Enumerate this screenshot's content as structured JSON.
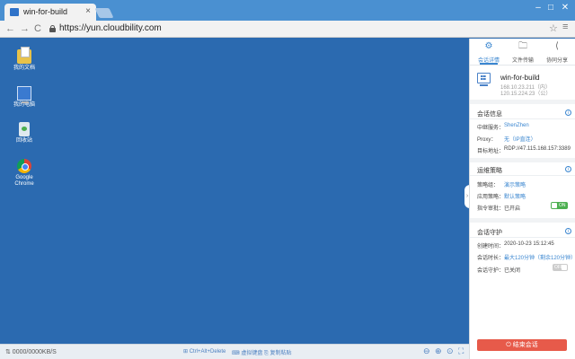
{
  "browser": {
    "tab_title": "win-for-build",
    "tab_close": "×",
    "url": "https://yun.cloudbility.com",
    "controls": {
      "minimize": "–",
      "maximize": "□",
      "close": "✕"
    },
    "nav": {
      "back": "←",
      "forward": "→",
      "reload": "C",
      "star": "☆",
      "menu": "≡"
    }
  },
  "desktop": {
    "icons": [
      {
        "label": "我的文档",
        "icon": "folder-docs-icon"
      },
      {
        "label": "我的电脑",
        "icon": "computer-icon"
      },
      {
        "label": "回收站",
        "icon": "recycle-bin-icon"
      },
      {
        "label": "Google Chrome",
        "icon": "chrome-icon"
      }
    ],
    "background_color": "#2b6ab0"
  },
  "statusbar": {
    "speed": "⇅ 0000/0000KB/S",
    "ctrl_alt_delete": "⊞ Ctrl+Alt+Delete",
    "virtual_keyboard": "⌨ 虚拟键盘",
    "clipboard": "⎘ 复制粘贴",
    "zoom_out": "⊖",
    "zoom_in": "⊕",
    "fit": "⊙",
    "fullscreen": "⛶"
  },
  "panel": {
    "tabs": [
      {
        "label": "会话详情",
        "icon": "gear-icon"
      },
      {
        "label": "文件传输",
        "icon": "file-transfer-icon"
      },
      {
        "label": "协同分享",
        "icon": "share-icon"
      }
    ],
    "host": {
      "name": "win-for-build",
      "ip_internal": "168.10.23.211（内）",
      "ip_public": "120.15.224.23（公）"
    },
    "session_info": {
      "title": "会话信息",
      "relay_label": "中继服务：",
      "relay_value": "ShenZhen",
      "proxy_label": "Proxy：",
      "proxy_value": "无（IP直连）",
      "target_label": "目标地址：",
      "target_value": "RDP://47.115.168.157:3389"
    },
    "control_policy": {
      "title": "运维策略",
      "group_label": "策略组：",
      "group_value": "演示策略",
      "apply_label": "应用策略：",
      "apply_value": "默认策略",
      "audit_label": "指令审批：",
      "audit_value": "已开启",
      "audit_toggle": "ON"
    },
    "session_guard": {
      "title": "会话守护",
      "created_label": "创建时间：",
      "created_value": "2020-10-23 15:12:45",
      "duration_label": "会话时长：",
      "duration_value": "最大120分钟（剩余120分钟）",
      "guard_label": "会话守护：",
      "guard_value": "已关闭",
      "guard_toggle": "OFF"
    },
    "info_glyph": "i",
    "end_button": "⏻ 结束会话",
    "accent_color": "#3a86d0",
    "danger_color": "#e75a4a"
  }
}
